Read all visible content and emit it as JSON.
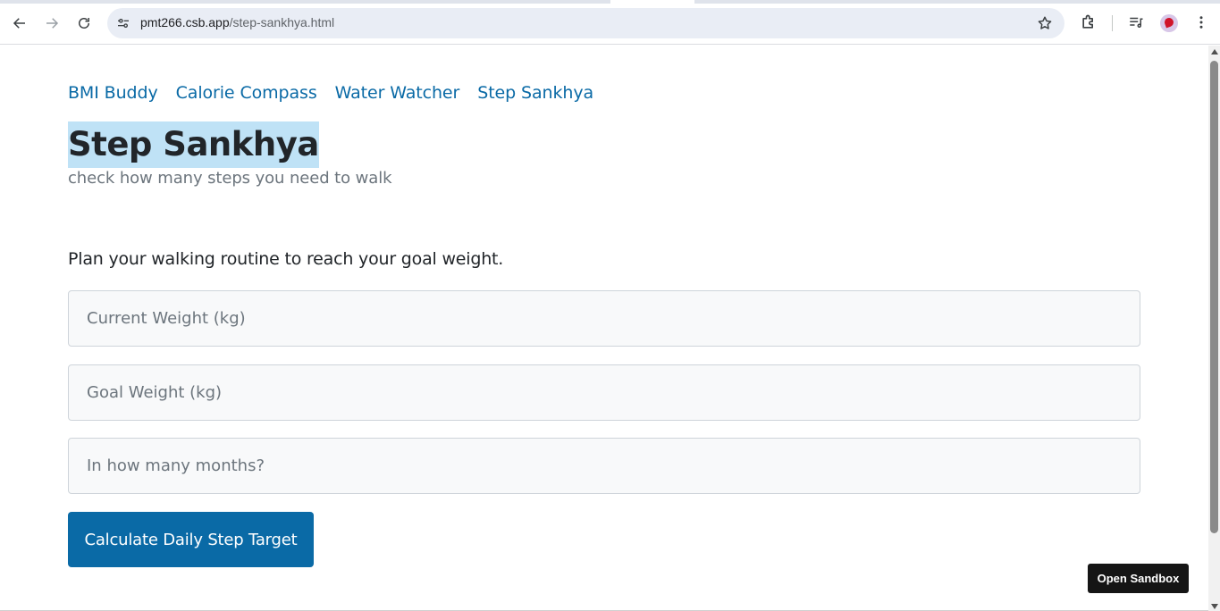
{
  "browser": {
    "url_host": "pmt266.csb.app",
    "url_path": "/step-sankhya.html",
    "icons": {
      "back": "arrow-left-icon",
      "forward": "arrow-right-icon",
      "reload": "reload-icon",
      "site_info": "tune-icon",
      "bookmark": "star-icon",
      "extensions": "puzzle-icon",
      "media": "media-queue-icon",
      "profile": "avatar",
      "menu": "kebab-menu-icon"
    }
  },
  "nav": {
    "links": [
      {
        "label": "BMI Buddy"
      },
      {
        "label": "Calorie Compass"
      },
      {
        "label": "Water Watcher"
      },
      {
        "label": "Step Sankhya"
      }
    ]
  },
  "header": {
    "title": "Step Sankhya",
    "subtitle": "check how many steps you need to walk"
  },
  "form": {
    "intro": "Plan your walking routine to reach your goal weight.",
    "current_weight_placeholder": "Current Weight (kg)",
    "goal_weight_placeholder": "Goal Weight (kg)",
    "months_placeholder": "In how many months?",
    "submit_label": "Calculate Daily Step Target"
  },
  "sandbox": {
    "button_label": "Open Sandbox"
  },
  "colors": {
    "link": "#0a6aa6",
    "primary": "#0a6aa6",
    "title_highlight": "#bfe2f6"
  }
}
